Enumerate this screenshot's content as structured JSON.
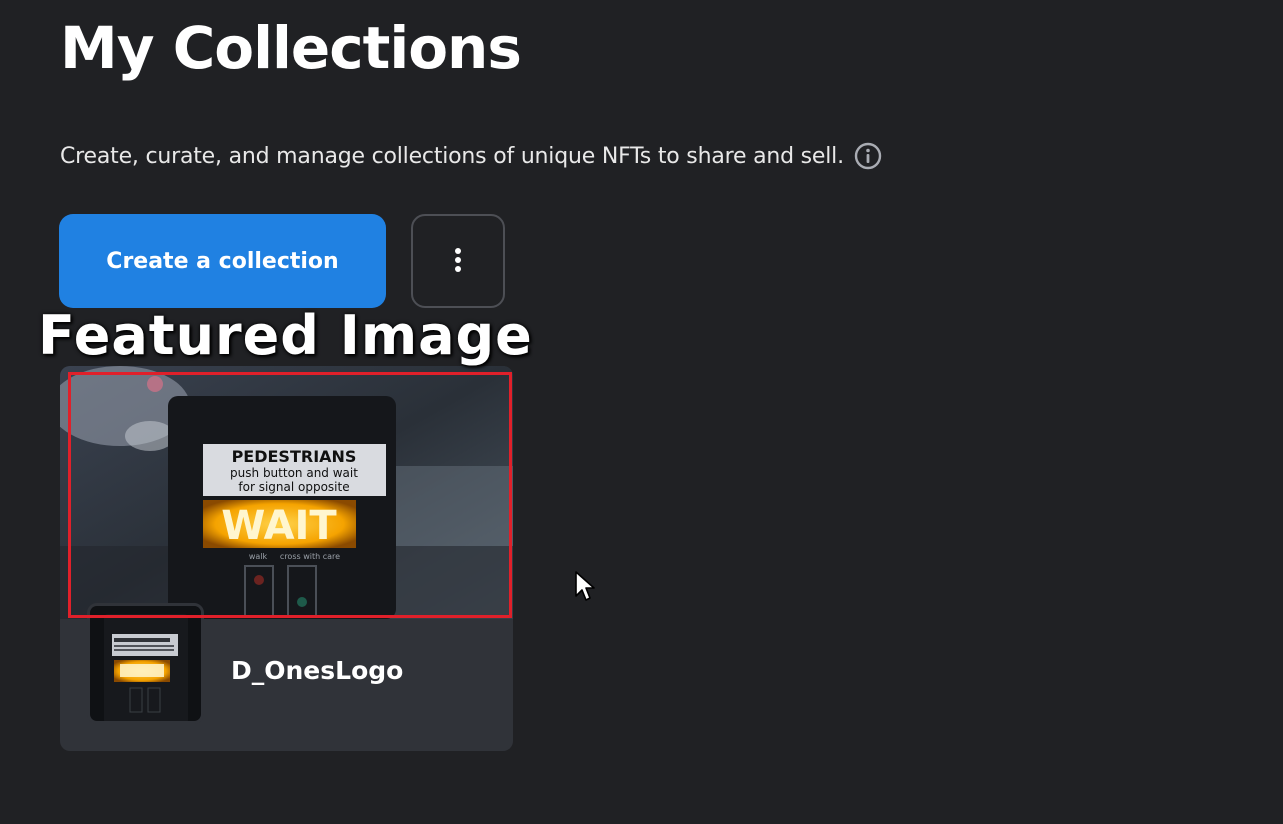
{
  "header": {
    "title": "My Collections",
    "subtitle": "Create, curate, and manage collections of unique NFTs to share and sell."
  },
  "actions": {
    "create_label": "Create a collection",
    "more_icon": "vertical-ellipsis-icon"
  },
  "annotation": {
    "label": "Featured Image",
    "highlight_color": "#e0202a"
  },
  "collections": [
    {
      "name": "D_OnesLogo",
      "sign_line1": "PEDESTRIANS",
      "sign_line2": "push button and wait",
      "sign_line3": "for signal opposite",
      "sign_wait": "WAIT",
      "sign_walk": "walk",
      "sign_cross": "cross with care"
    }
  ],
  "colors": {
    "background": "#202124",
    "card": "#303339",
    "accent": "#2081e2"
  }
}
